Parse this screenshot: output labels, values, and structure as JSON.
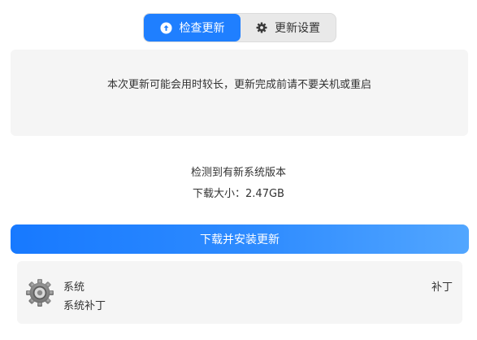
{
  "tabs": {
    "check_updates_label": "检查更新",
    "update_settings_label": "更新设置"
  },
  "notice": {
    "text": "本次更新可能会用时较长，更新完成前请不要关机或重启"
  },
  "status": {
    "found_text": "检测到有新系统版本",
    "download_size_text": "下载大小：2.47GB"
  },
  "actions": {
    "download_install_label": "下载并安装更新"
  },
  "update_item": {
    "name": "系统",
    "description": "系统补丁",
    "type": "补丁"
  },
  "colors": {
    "accent": "#1f7fff",
    "panel_bg": "#f5f5f5"
  },
  "icons": {
    "check_tab": "arrow-up-circle-icon",
    "settings_tab": "gear-icon",
    "item": "system-gear-icon"
  }
}
